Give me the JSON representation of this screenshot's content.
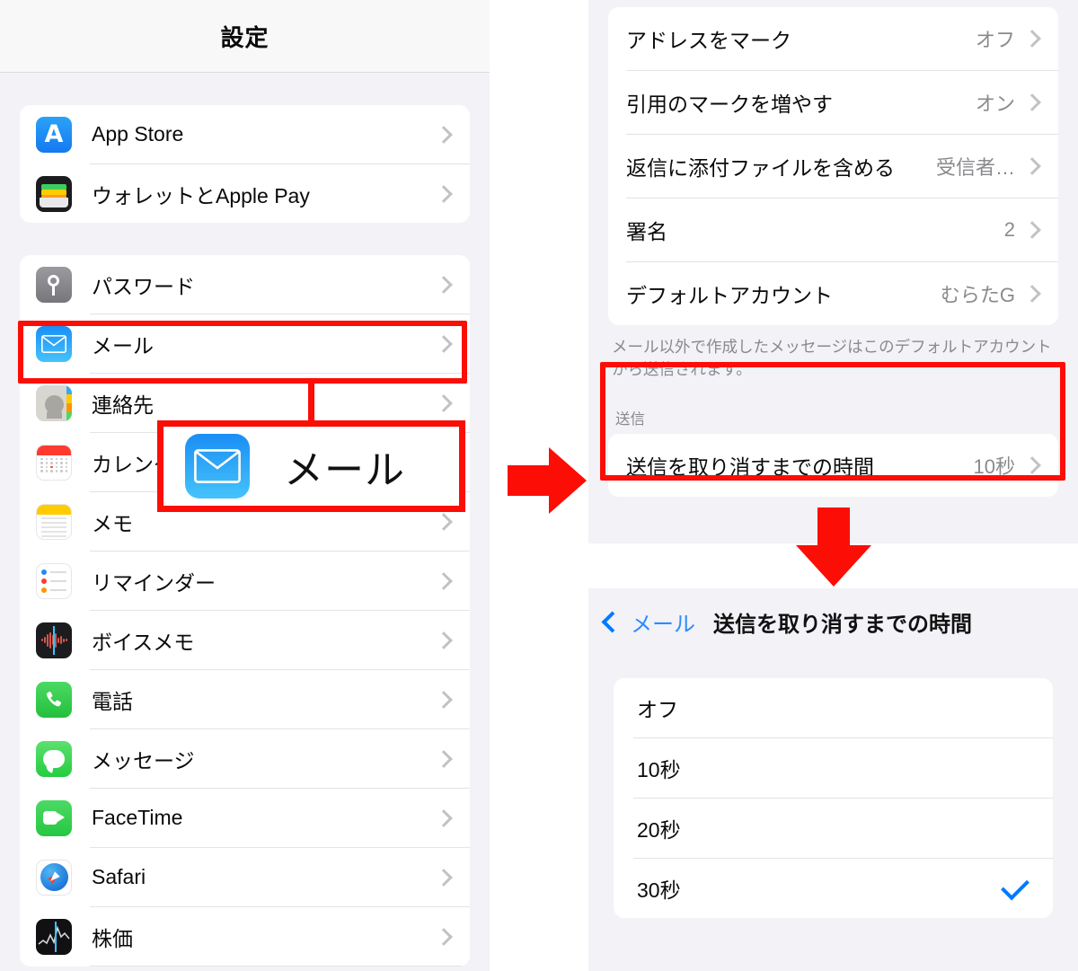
{
  "left_panel": {
    "header_title": "設定",
    "group1": [
      {
        "label": "App Store",
        "icon": "appstore-icon"
      },
      {
        "label": "ウォレットとApple Pay",
        "icon": "wallet-icon"
      }
    ],
    "group2": [
      {
        "label": "パスワード",
        "icon": "passwords-icon"
      },
      {
        "label": "メール",
        "icon": "mail-icon"
      },
      {
        "label": "連絡先",
        "icon": "contacts-icon"
      },
      {
        "label": "カレンダー",
        "icon": "calendar-icon"
      },
      {
        "label": "メモ",
        "icon": "notes-icon"
      },
      {
        "label": "リマインダー",
        "icon": "reminders-icon"
      },
      {
        "label": "ボイスメモ",
        "icon": "voice-memos-icon"
      },
      {
        "label": "電話",
        "icon": "phone-icon"
      },
      {
        "label": "メッセージ",
        "icon": "messages-icon"
      },
      {
        "label": "FaceTime",
        "icon": "facetime-icon"
      },
      {
        "label": "Safari",
        "icon": "safari-icon"
      },
      {
        "label": "株価",
        "icon": "stocks-icon"
      }
    ]
  },
  "right_top_panel": {
    "rows": [
      {
        "label": "アドレスをマーク",
        "value": "オフ"
      },
      {
        "label": "引用のマークを増やす",
        "value": "オン"
      },
      {
        "label": "返信に添付ファイルを含める",
        "value": "受信者…"
      },
      {
        "label": "署名",
        "value": "2"
      },
      {
        "label": "デフォルトアカウント",
        "value": "むらたG"
      }
    ],
    "footnote": "メール以外で作成したメッセージはこのデフォルトアカウントから送信されます。",
    "send_section": {
      "header": "送信",
      "row": {
        "label": "送信を取り消すまでの時間",
        "value": "10秒"
      }
    }
  },
  "right_bottom_panel": {
    "back_label": "メール",
    "title": "送信を取り消すまでの時間",
    "options": [
      {
        "label": "オフ",
        "selected": false
      },
      {
        "label": "10秒",
        "selected": false
      },
      {
        "label": "20秒",
        "selected": false
      },
      {
        "label": "30秒",
        "selected": true
      }
    ]
  },
  "callout": {
    "label": "メール",
    "icon": "mail-icon"
  },
  "annotations": {
    "accent_color": "#fc0d06",
    "arrow_right": "arrow-right-icon",
    "arrow_down": "arrow-down-icon"
  }
}
